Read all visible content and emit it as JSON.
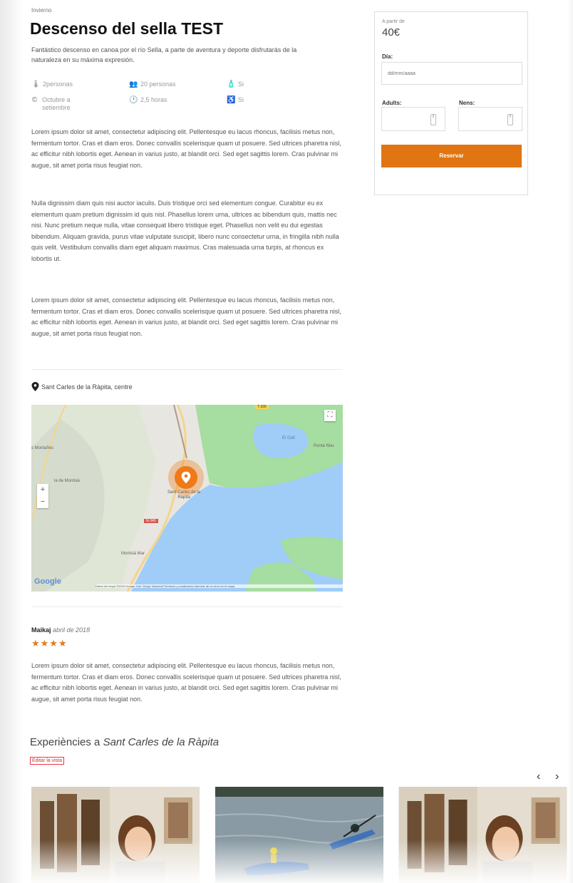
{
  "activity": {
    "category": "Invierno",
    "title": "Descenso del sella TEST",
    "intro": "Fantástico descenso en canoa por el río Sella, a parte de aventura y deporte disfrutarás de la naturaleza en su máxima expresión.",
    "features": [
      {
        "icon": "thermometer-icon",
        "glyph": "🌡",
        "text": "2personas"
      },
      {
        "icon": "group-icon",
        "glyph": "👥",
        "text": "20 personas"
      },
      {
        "icon": "bottle-icon",
        "glyph": "🧴",
        "text": "Si"
      },
      {
        "icon": "calendar-icon",
        "glyph": "©",
        "text": "Octubre a setiembre"
      },
      {
        "icon": "clock-icon",
        "glyph": "🕐",
        "text": "2,5 horas"
      },
      {
        "icon": "accessibility-icon",
        "glyph": "♿",
        "text": "Si"
      }
    ],
    "paragraphs": [
      "Lorem ipsum dolor sit amet, consectetur adipiscing elit. Pellentesque eu lacus rhoncus, facilisis metus non, fermentum tortor. Cras et diam eros. Donec convallis scelerisque quam ut posuere. Sed ultrices pharetra nisl, ac efficitur nibh lobortis eget. Aenean in varius justo, at blandit orci. Sed eget sagittis lorem. Cras pulvinar mi augue, sit amet porta risus feugiat non.",
      "Nulla dignissim diam quis nisi auctor iaculis. Duis tristique orci sed elementum congue. Curabitur eu ex elementum quam pretium dignissim id quis nisl. Phasellus lorem urna, ultrices ac bibendum quis, mattis nec nisi. Nunc pretium neque nulla, vitae consequat libero tristique eget. Phasellus non velit eu dui egestas bibendum. Aliquam gravida, purus vitae vulputate suscipit, libero nunc consectetur urna, in fringilla nibh nulla quis velit. Vestibulum convallis diam eget aliquam maximus. Cras malesuada urna turpis, at rhoncus ex lobortis ut.",
      "Lorem ipsum dolor sit amet, consectetur adipiscing elit. Pellentesque eu lacus rhoncus, facilisis metus non, fermentum tortor. Cras et diam eros. Donec convallis scelerisque quam ut posuere. Sed ultrices pharetra nisl, ac efficitur nibh lobortis eget. Aenean in varius justo, at blandit orci. Sed eget sagittis lorem. Cras pulvinar mi augue, sit amet porta risus feugiat non."
    ]
  },
  "location": {
    "text": "Sant Carles de la Ràpita, centre",
    "icon": "map-pin-icon"
  },
  "map": {
    "label_town": "Sant Carles de la Ràpita",
    "label_west": "s Montañes",
    "label_poi": "la de Montsià",
    "label_bottom": "Montsià Mar",
    "label_bay": "El Goll",
    "label_point": "Punta Nou",
    "road_sign": "T-330",
    "road_sign2": "N-340",
    "zoom_in": "+",
    "zoom_out": "−",
    "google": "Google",
    "attribution": "Datos del mapa ©2018 Google, Inst. Geogr. Nacional   Términos y condiciones   Informar de un error en el mapa",
    "colors": {
      "land": "#e8e6e0",
      "water": "#9fcdf8",
      "park": "#a6dda0",
      "marker": "#ef7a17"
    }
  },
  "review": {
    "author": "Maikaj",
    "date": "abril de 2018",
    "stars": "★★★★",
    "text": "Lorem ipsum dolor sit amet, consectetur adipiscing elit. Pellentesque eu lacus rhoncus, facilisis metus non, fermentum tortor. Cras et diam eros. Donec convallis scelerisque quam ut posuere. Sed ultrices pharetra nisl, ac efficitur nibh lobortis eget. Aenean in varius justo, at blandit orci. Sed eget sagittis lorem. Cras pulvinar mi augue, sit amet porta risus feugiat non."
  },
  "experiences": {
    "title_prefix": "Experiències a",
    "title_place": "Sant Carles de la Ràpita",
    "edit_label": "Editar la vista",
    "prev": "‹",
    "next": "›"
  },
  "booking": {
    "from_label": "A partir de",
    "price": "40€",
    "day_label": "Día:",
    "day_placeholder": "dd/mm/aaaa",
    "adults_label": "Adults:",
    "kids_label": "Nens:",
    "book_label": "Reservar",
    "accent": "#e07512"
  }
}
